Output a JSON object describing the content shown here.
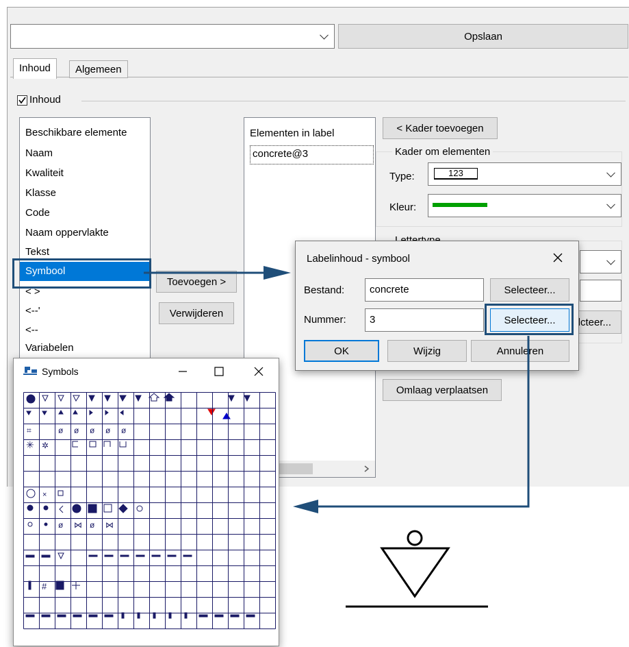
{
  "toolbar": {
    "dropdown_value": "",
    "save_label": "Opslaan"
  },
  "tabs": [
    {
      "label": "Inhoud"
    },
    {
      "label": "Algemeen"
    }
  ],
  "inhoud_group": {
    "label": "Inhoud",
    "checked": true
  },
  "available": {
    "header": "Beschikbare elemente",
    "items": [
      "Naam",
      "Kwaliteit",
      "Klasse",
      "Code",
      "Naam oppervlakte",
      "Tekst",
      "Symbool",
      "< >",
      "<--'",
      "<--",
      "Variabelen"
    ],
    "selected": "Symbool"
  },
  "buttons": {
    "add": "Toevoegen >",
    "remove": "Verwijderen",
    "add_frame": "< Kader toevoegen",
    "move_down": "Omlaag verplaatsen"
  },
  "in_label": {
    "header": "Elementen in label",
    "items": [
      "concrete@3"
    ]
  },
  "frame": {
    "group_label": "Kader om elementen",
    "type_label": "Type:",
    "type_value": "123",
    "color_label": "Kleur:",
    "color_value": "#00a000"
  },
  "font_group": {
    "label": "Lettertype"
  },
  "dialog": {
    "title": "Labelinhoud - symbool",
    "file_label": "Bestand:",
    "file_value": "concrete",
    "select1": "Selecteer...",
    "number_label": "Nummer:",
    "number_value": "3",
    "select2": "Selecteer...",
    "ok": "OK",
    "edit": "Wijzig",
    "cancel": "Annuleren"
  },
  "behind": {
    "select_text": "lcteer..."
  },
  "symbols_window": {
    "title": "Symbols",
    "grid_cols": 16,
    "grid_rows": 25
  },
  "colors": {
    "accent": "#0078d7",
    "highlight": "#1f4e79",
    "symbol_ink": "#1a1a66"
  }
}
